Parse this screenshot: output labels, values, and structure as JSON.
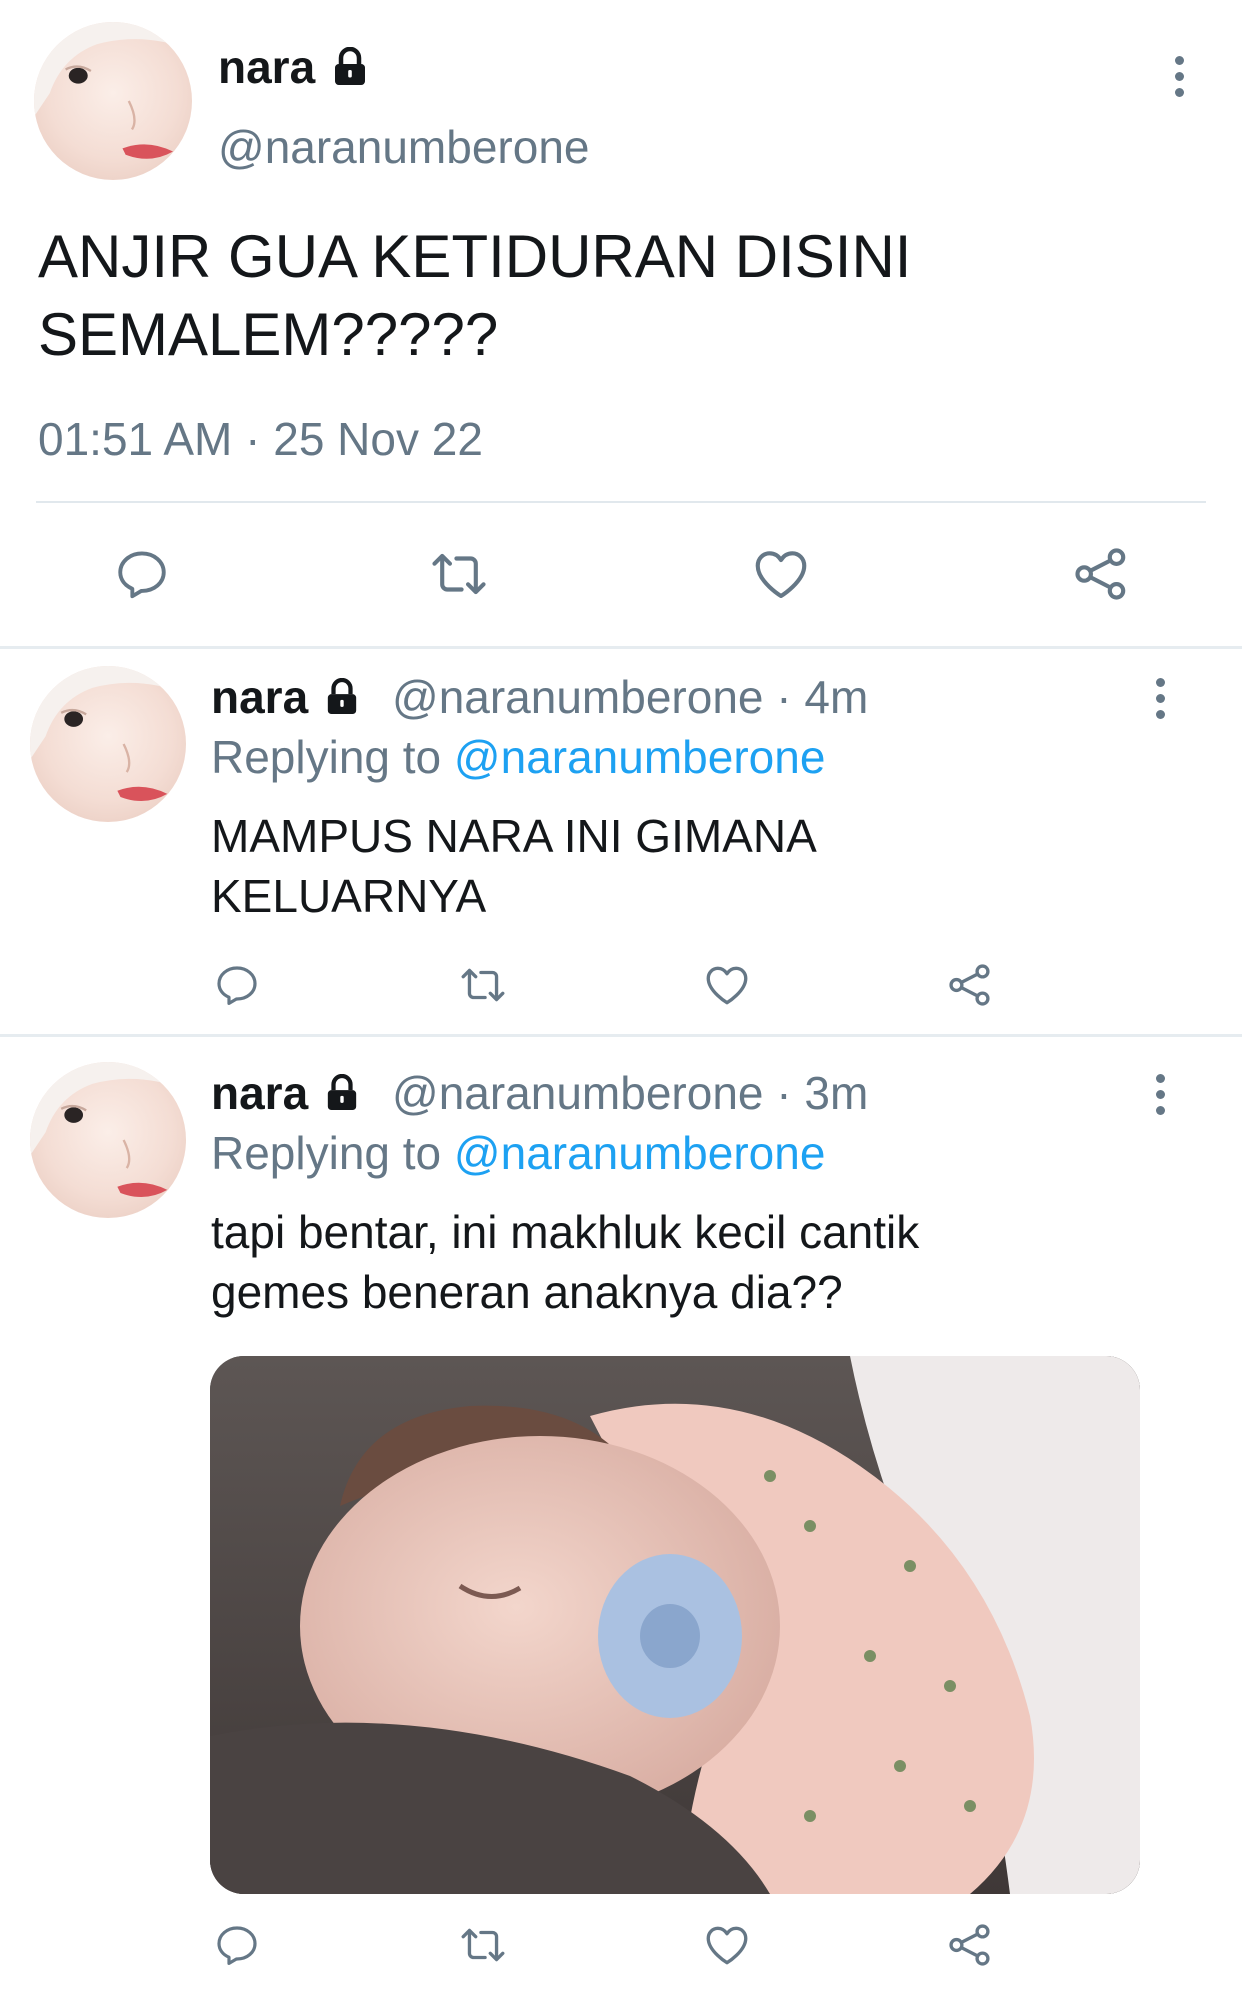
{
  "main_tweet": {
    "display_name": "nara",
    "handle": "@naranumberone",
    "text_line1": "ANJIR GUA KETIDURAN DISINI",
    "text_line2": "SEMALEM?????",
    "timestamp": "01:51 AM · 25 Nov 22",
    "icons": [
      "lock-icon",
      "more-icon",
      "reply-icon",
      "retweet-icon",
      "like-icon",
      "share-icon"
    ]
  },
  "replies": [
    {
      "display_name": "nara",
      "handle_time": "@naranumberone · 4m",
      "replying_prefix": "Replying to",
      "replying_handle": "@naranumberone",
      "text_line1": "MAMPUS NARA INI GIMANA",
      "text_line2": "KELUARNYA"
    },
    {
      "display_name": "nara",
      "handle_time": "@naranumberone · 3m",
      "replying_prefix": "Replying to",
      "replying_handle": "@naranumberone",
      "text_line1": "tapi bentar, ini makhluk kecil cantik",
      "text_line2": "gemes beneran anaknya dia??",
      "media": "photo-sleeping-baby-with-pacifier"
    }
  ],
  "colors": {
    "text": "#14171a",
    "secondary": "#657786",
    "link": "#1da1f2",
    "divider": "#e6ecf0"
  }
}
